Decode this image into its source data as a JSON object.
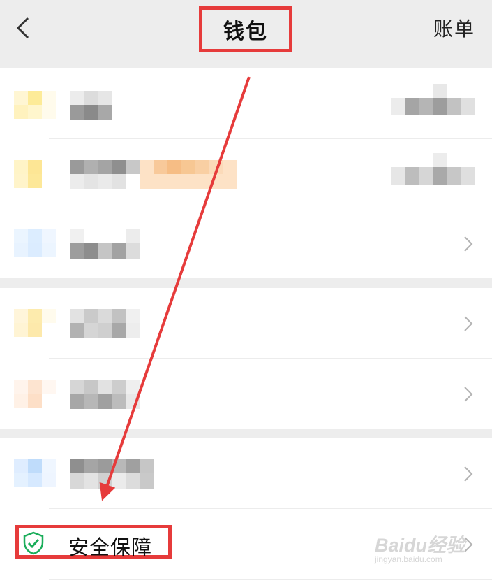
{
  "nav": {
    "title": "钱包",
    "bill_link": "账单"
  },
  "security": {
    "label": "安全保障"
  },
  "watermark": {
    "main": "Baidu经验",
    "sub": "jingyan.baidu.com"
  },
  "colors": {
    "annotation_red": "#e63b3b",
    "shield_green": "#1aad5a",
    "nav_bg": "#ededed"
  }
}
